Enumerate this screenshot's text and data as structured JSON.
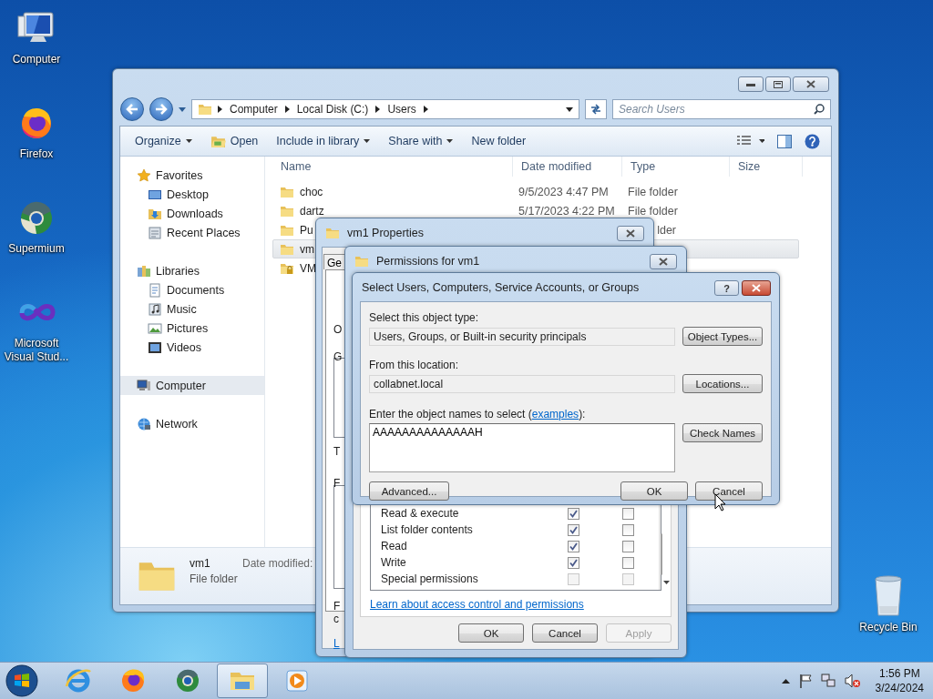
{
  "desktop_icons": [
    {
      "label": "Computer",
      "kind": "computer"
    },
    {
      "label": "Firefox",
      "kind": "firefox"
    },
    {
      "label": "Supermium",
      "kind": "supermium"
    },
    {
      "label": "Microsoft Visual Stud...",
      "kind": "vs"
    }
  ],
  "recycle_bin": {
    "label": "Recycle Bin"
  },
  "explorer": {
    "breadcrumbs": [
      "Computer",
      "Local Disk (C:)",
      "Users"
    ],
    "search": {
      "placeholder": "Search Users"
    },
    "toolbar": [
      {
        "label": "Organize",
        "kind": "menu"
      },
      {
        "label": "Open",
        "kind": "open"
      },
      {
        "label": "Include in library",
        "kind": "menu"
      },
      {
        "label": "Share with",
        "kind": "menu"
      },
      {
        "label": "New folder",
        "kind": "plain"
      }
    ],
    "nav": [
      {
        "label": "Favorites",
        "kind": "favorites",
        "selected": false,
        "children": [
          {
            "label": "Desktop",
            "kind": "desktop",
            "selected": false
          },
          {
            "label": "Downloads",
            "kind": "downloads",
            "selected": false
          },
          {
            "label": "Recent Places",
            "kind": "recent",
            "selected": false
          }
        ]
      },
      {
        "label": "Libraries",
        "kind": "libraries",
        "selected": false,
        "children": [
          {
            "label": "Documents",
            "kind": "documents",
            "selected": false
          },
          {
            "label": "Music",
            "kind": "music",
            "selected": false
          },
          {
            "label": "Pictures",
            "kind": "pictures",
            "selected": false
          },
          {
            "label": "Videos",
            "kind": "videos",
            "selected": false
          }
        ]
      },
      {
        "label": "Computer",
        "kind": "computer",
        "selected": true
      },
      {
        "label": "Network",
        "kind": "network",
        "selected": false
      }
    ],
    "columns": [
      "Name",
      "Date modified",
      "Type",
      "Size"
    ],
    "rows": [
      {
        "name": "choc",
        "date": "9/5/2023 4:47 PM",
        "type": "File folder",
        "kind": "folder",
        "selected": false
      },
      {
        "name": "dartz",
        "date": "5/17/2023 4:22 PM",
        "type": "File folder",
        "kind": "folder",
        "selected": false
      },
      {
        "name": "Pu",
        "type": "lder",
        "kind": "folder",
        "selected": false
      },
      {
        "name": "vm",
        "kind": "folder",
        "selected": true
      },
      {
        "name": "VM",
        "kind": "locked-folder",
        "selected": false
      }
    ],
    "details": {
      "name": "vm1",
      "type": "File folder",
      "date_label": "Date modified:"
    }
  },
  "properties": {
    "title": "vm1 Properties",
    "tab": "Ge",
    "fragments": [
      {
        "text": "O",
        "kind": "label"
      },
      {
        "text": "G",
        "kind": "label"
      },
      {
        "text": "T",
        "kind": "label"
      },
      {
        "text": "F",
        "kind": "label"
      },
      {
        "text": "F",
        "kind": "label"
      },
      {
        "text": "c",
        "kind": "label"
      },
      {
        "text": "L",
        "kind": "link"
      }
    ]
  },
  "permissions": {
    "title": "Permissions for vm1",
    "rows": [
      {
        "label": "Read & execute",
        "allow": true,
        "deny": false,
        "disabled": false
      },
      {
        "label": "List folder contents",
        "allow": true,
        "deny": false,
        "disabled": false
      },
      {
        "label": "Read",
        "allow": true,
        "deny": false,
        "disabled": false
      },
      {
        "label": "Write",
        "allow": true,
        "deny": false,
        "disabled": false
      },
      {
        "label": "Special permissions",
        "allow": false,
        "deny": false,
        "disabled": true
      }
    ],
    "link": "Learn about access control and permissions",
    "buttons": [
      {
        "label": "OK",
        "disabled": false
      },
      {
        "label": "Cancel",
        "disabled": false
      },
      {
        "label": "Apply",
        "disabled": true
      }
    ]
  },
  "select_dialog": {
    "title": "Select Users, Computers, Service Accounts, or Groups",
    "help": "?",
    "type_label": "Select this object type:",
    "type_value": "Users, Groups, or Built-in security principals",
    "type_button": "Object Types...",
    "location_label": "From this location:",
    "location_value": "collabnet.local",
    "location_button": "Locations...",
    "names_prompt": {
      "before": "Enter the object names to select (",
      "link": "examples",
      "after": "):"
    },
    "names_value": "AAAAAAAAAAAAAAH",
    "check_button": "Check Names",
    "advanced_button": "Advanced...",
    "ok_button": "OK",
    "cancel_button": "Cancel"
  },
  "taskbar": {
    "apps": [
      {
        "kind": "ie",
        "active": false
      },
      {
        "kind": "firefox",
        "active": false
      },
      {
        "kind": "supermium",
        "active": false
      },
      {
        "kind": "explorer",
        "active": true
      },
      {
        "kind": "media",
        "active": false
      }
    ],
    "time": "1:56 PM",
    "date": "3/24/2024"
  }
}
